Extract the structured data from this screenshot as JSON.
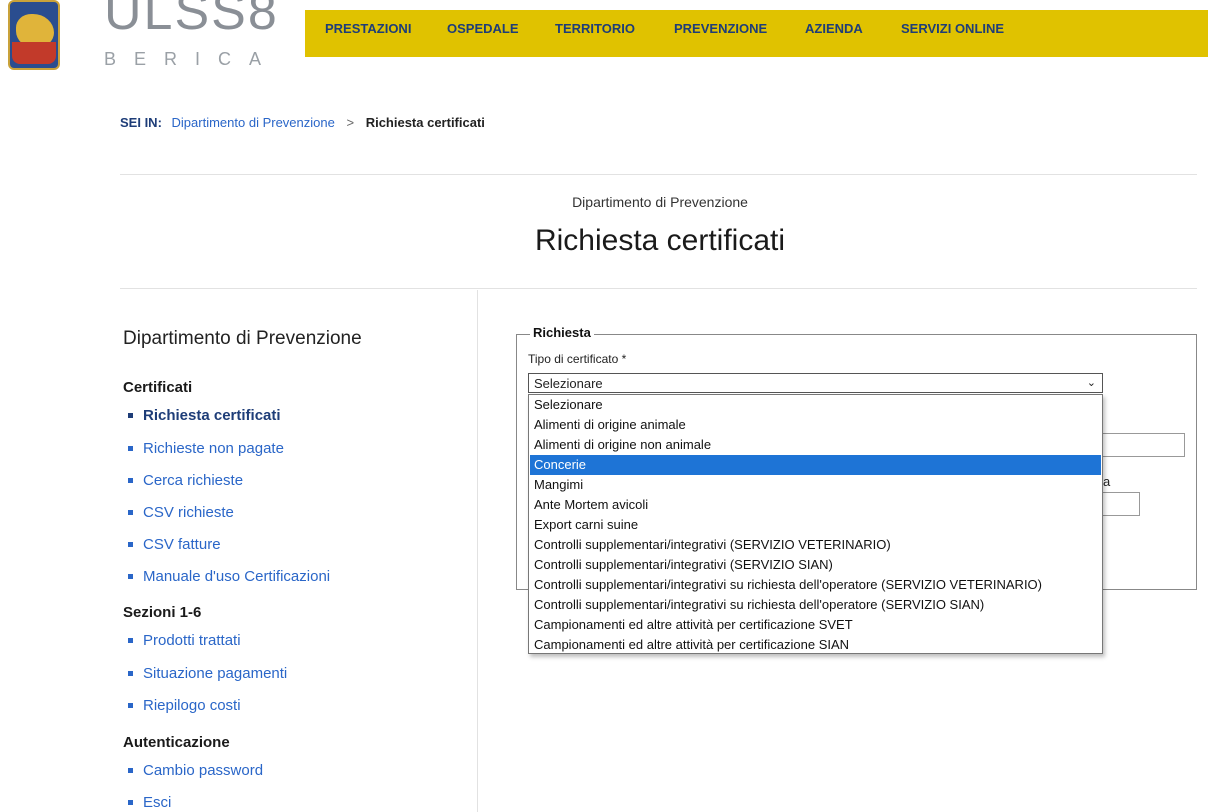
{
  "logo": {
    "text": "ULSS8",
    "sub": "BERICA"
  },
  "nav": [
    "PRESTAZIONI",
    "OSPEDALE",
    "TERRITORIO",
    "PREVENZIONE",
    "AZIENDA",
    "SERVIZI ONLINE"
  ],
  "breadcrumb": {
    "label": "SEI IN:",
    "parent": "Dipartimento di Prevenzione",
    "separator": ">",
    "current": "Richiesta certificati"
  },
  "page": {
    "department": "Dipartimento di Prevenzione",
    "title": "Richiesta certificati"
  },
  "sidebar": {
    "title": "Dipartimento di Prevenzione",
    "sections": [
      {
        "heading": "Certificati",
        "items": [
          "Richiesta certificati",
          "Richieste non pagate",
          "Cerca richieste",
          "CSV richieste",
          "CSV fatture",
          "Manuale d'uso Certificazioni"
        ]
      },
      {
        "heading": "Sezioni 1-6",
        "items": [
          "Prodotti trattati",
          "Situazione pagamenti",
          "Riepilogo costi"
        ]
      },
      {
        "heading": "Autenticazione",
        "items": [
          "Cambio password",
          "Esci"
        ]
      }
    ]
  },
  "form": {
    "legend": "Richiesta",
    "certificate_label": "Tipo di certificato *",
    "selected_value": "Selezionare",
    "hidden_letter": "a",
    "options": [
      "Selezionare",
      "Alimenti di origine animale",
      "Alimenti di origine non animale",
      "Concerie",
      "Mangimi",
      "Ante Mortem avicoli",
      "Export carni suine",
      "Controlli supplementari/integrativi (SERVIZIO VETERINARIO)",
      "Controlli supplementari/integrativi (SERVIZIO SIAN)",
      "Controlli supplementari/integrativi su richiesta dell'operatore (SERVIZIO VETERINARIO)",
      "Controlli supplementari/integrativi su richiesta dell'operatore (SERVIZIO SIAN)",
      "Campionamenti ed altre attività per certificazione SVET",
      "Campionamenti ed altre attività per certificazione SIAN"
    ],
    "highlighted_option": "Concerie"
  },
  "colors": {
    "nav_bg": "#e0c200",
    "nav_text": "#1e3d78",
    "link": "#2a66c8",
    "highlight": "#1e74d6"
  }
}
